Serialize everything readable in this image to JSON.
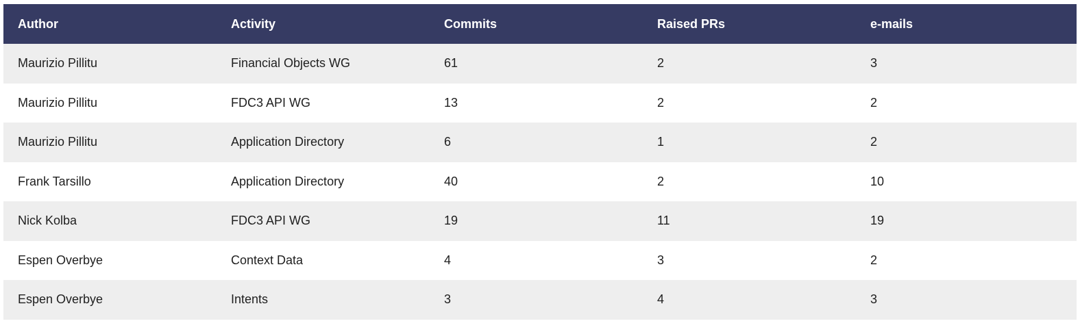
{
  "table": {
    "headers": [
      "Author",
      "Activity",
      "Commits",
      "Raised PRs",
      "e-mails"
    ],
    "rows": [
      [
        "Maurizio Pillitu",
        "Financial Objects WG",
        "61",
        "2",
        "3"
      ],
      [
        "Maurizio Pillitu",
        "FDC3 API WG",
        "13",
        "2",
        "2"
      ],
      [
        "Maurizio Pillitu",
        "Application Directory",
        "6",
        "1",
        "2"
      ],
      [
        "Frank Tarsillo",
        "Application Directory",
        "40",
        "2",
        "10"
      ],
      [
        "Nick Kolba",
        "FDC3 API WG",
        "19",
        "11",
        "19"
      ],
      [
        "Espen Overbye",
        "Context Data",
        "4",
        "3",
        "2"
      ],
      [
        "Espen Overbye",
        "Intents",
        "3",
        "4",
        "3"
      ]
    ]
  },
  "colors": {
    "header_bg": "#363b63",
    "header_text": "#ffffff",
    "row_alt_bg": "#eeeeee"
  }
}
